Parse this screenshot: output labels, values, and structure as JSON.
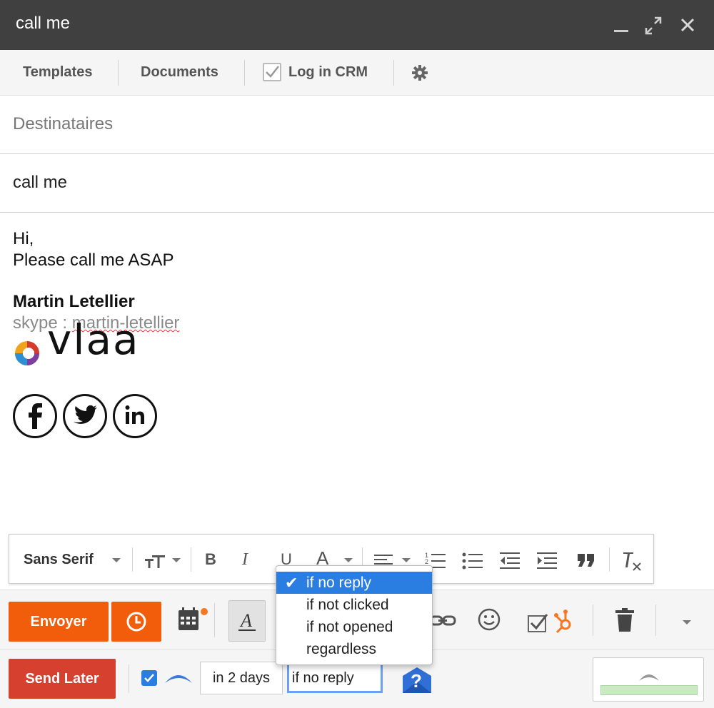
{
  "window": {
    "title": "call me"
  },
  "toolbar": {
    "templates": "Templates",
    "documents": "Documents",
    "log_crm": "Log in CRM"
  },
  "compose": {
    "recipients_placeholder": "Destinataires",
    "subject": "call me",
    "body_line1": "Hi,",
    "body_line2": "Please call me ASAP",
    "signature_name": "Martin Letellier",
    "skype_label": "skype : ",
    "skype_handle": "martin-letellier",
    "logo_text": "vlaa"
  },
  "format_toolbar": {
    "font": "Sans Serif"
  },
  "actions": {
    "send": "Envoyer"
  },
  "send_later": {
    "button": "Send Later",
    "delay": "in 2 days",
    "condition": "if no reply",
    "options": [
      "if no reply",
      "if not clicked",
      "if not opened",
      "regardless"
    ],
    "selected_index": 0
  },
  "colors": {
    "titlebar": "#404040",
    "send": "#f25d0c",
    "send_later": "#d6402f",
    "accent_blue": "#2a7de1",
    "hubspot": "#f57722"
  }
}
